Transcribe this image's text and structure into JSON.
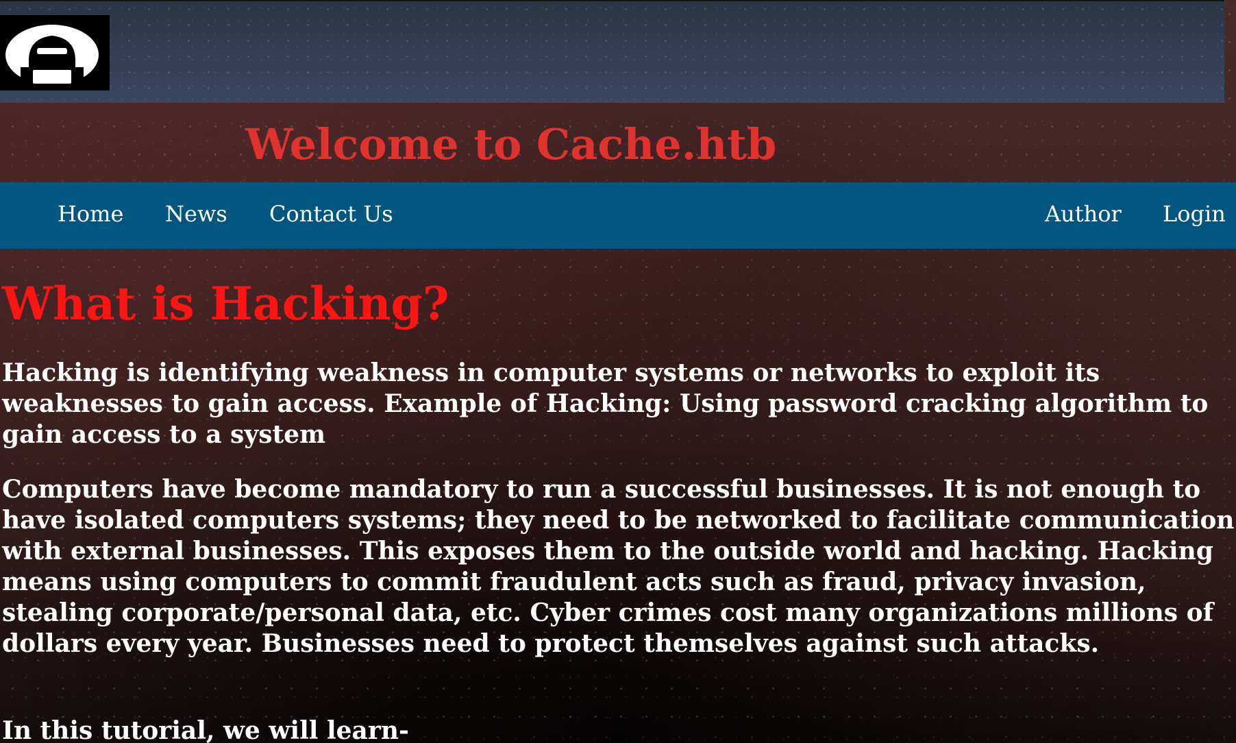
{
  "header": {
    "logo_icon": "hacker-hood-icon",
    "title": "Welcome to Cache.htb"
  },
  "nav": {
    "home": "Home",
    "news": "News",
    "contact": "Contact Us",
    "author": "Author",
    "login": "Login"
  },
  "main": {
    "heading": "What is Hacking?",
    "paragraph1": "Hacking is identifying weakness in computer systems or networks to exploit its weaknesses to gain access. Example of Hacking: Using password cracking algorithm to gain access to a system",
    "paragraph2": "Computers have become mandatory to run a successful businesses. It is not enough to have isolated computers systems; they need to be networked to facilitate communication with external businesses. This exposes them to the outside world and hacking. Hacking means using computers to commit fraudulent acts such as fraud, privacy invasion, stealing corporate/personal data, etc. Cyber crimes cost many organizations millions of dollars every year. Businesses need to protect themselves against such attacks.",
    "paragraph3": "In this tutorial, we will learn-"
  },
  "colors": {
    "title_red": "#e0322f",
    "heading_red": "#ff1414",
    "nav_blue": "#035680",
    "banner_slate": "#344057"
  }
}
